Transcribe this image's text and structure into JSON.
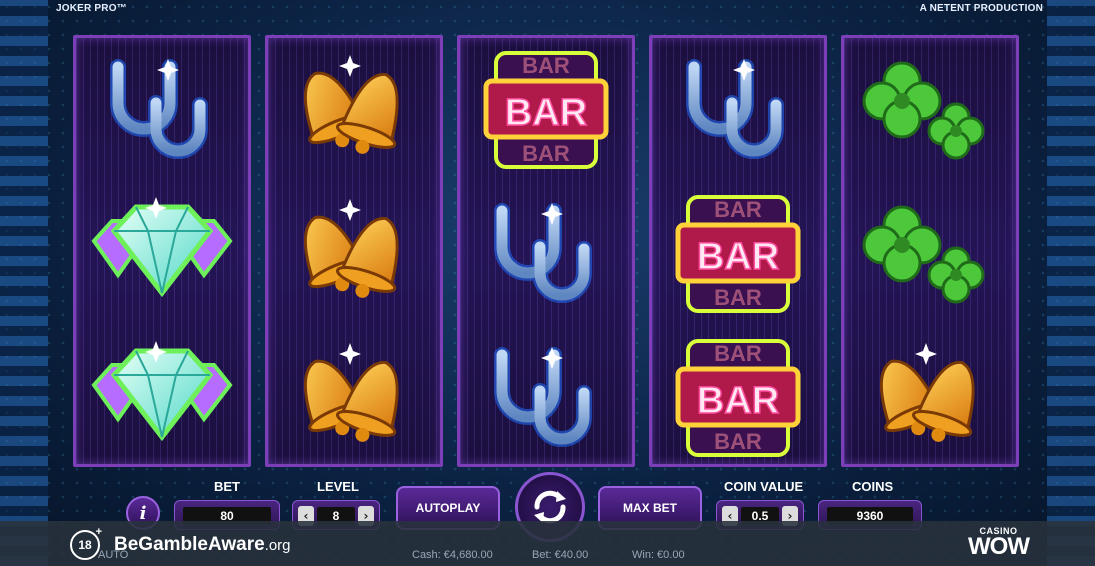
{
  "header": {
    "game_title": "JOKER PRO™",
    "producer": "A NETENT PRODUCTION"
  },
  "reels": [
    [
      "horseshoe",
      "diamond",
      "diamond"
    ],
    [
      "bells",
      "bells",
      "bells"
    ],
    [
      "bar",
      "horseshoe",
      "horseshoe"
    ],
    [
      "horseshoe",
      "bar",
      "bar"
    ],
    [
      "clover",
      "clover",
      "bells"
    ]
  ],
  "symbol_text": {
    "bar": "BAR"
  },
  "controls": {
    "info_label": "i",
    "bet": {
      "label": "BET",
      "value": "80"
    },
    "level": {
      "label": "LEVEL",
      "value": "8",
      "dec": "‹",
      "inc": "›"
    },
    "autoplay": "AUTOPLAY",
    "max_bet": "MAX BET",
    "coin_value": {
      "label": "COIN VALUE",
      "value": "0.5",
      "dec": "‹",
      "inc": "›"
    },
    "coins": {
      "label": "COINS",
      "value": "9360"
    }
  },
  "status": {
    "auto": "AUTO",
    "cash": "Cash: €4,680.00",
    "bet": "Bet: €40.00",
    "win": "Win: €0.00"
  },
  "footer": {
    "age": "18",
    "age_plus": "+",
    "gamble_aware_main": "BeGambleAware",
    "gamble_aware_org": ".org",
    "casino_small": "CASINO",
    "casino_big": "WOW"
  },
  "colors": {
    "reel_border": "#7c3fb8",
    "reel_bg": "#241455",
    "panel_button": "#5a2a98"
  }
}
